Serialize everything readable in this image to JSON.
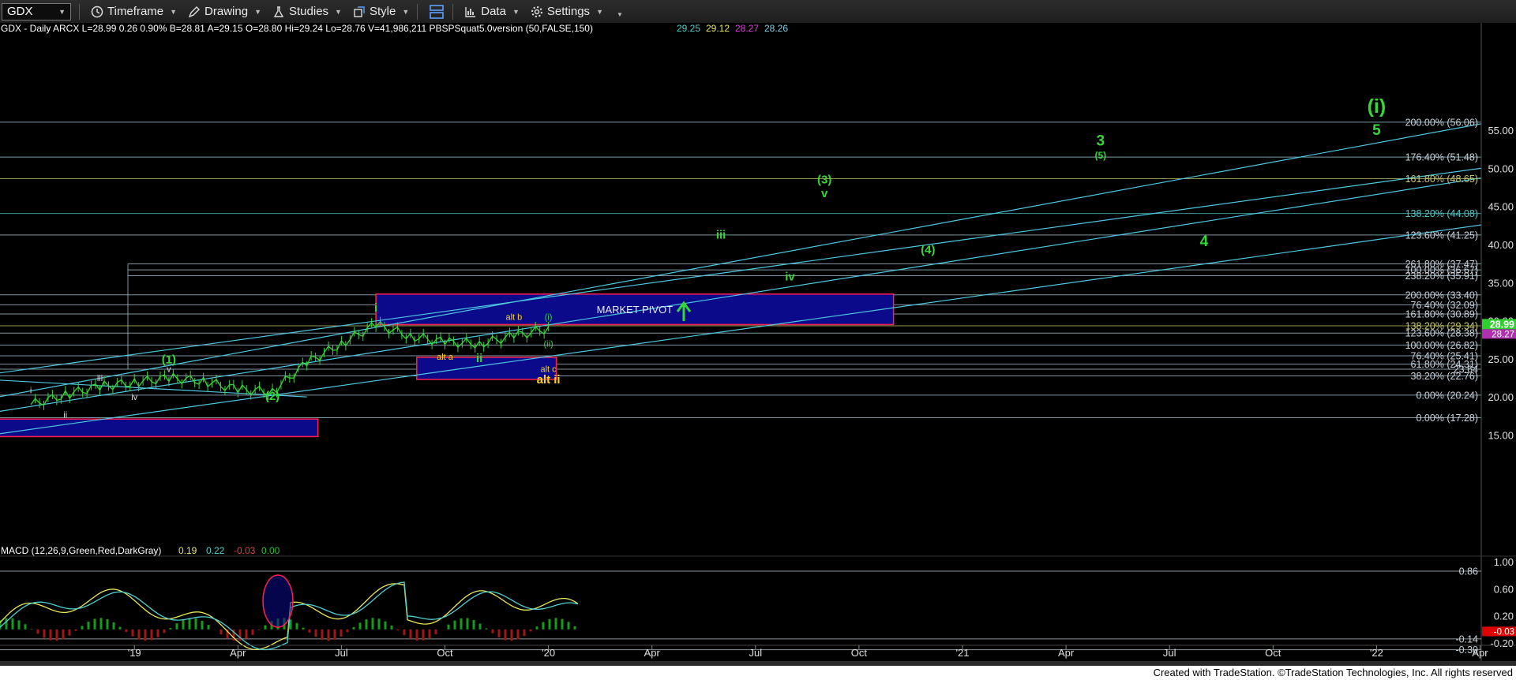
{
  "toolbar": {
    "symbol": "GDX",
    "timeframe_label": "Timeframe",
    "drawing_label": "Drawing",
    "studies_label": "Studies",
    "style_label": "Style",
    "data_label": "Data",
    "settings_label": "Settings"
  },
  "header": {
    "symbol_line": "GDX - Daily  ARCX  L=28.99  0.26  0.90%  B=28.81  A=29.15  O=28.80  Hi=29.24  Lo=28.76  V=41,986,211  PBSPSquat5.0version (50,FALSE,150)",
    "study_values": [
      {
        "text": "29.25",
        "color": "#4fd0d0"
      },
      {
        "text": "29.12",
        "color": "#e8e85a"
      },
      {
        "text": "28.27",
        "color": "#e040e0"
      },
      {
        "text": "28.26",
        "color": "#7fd0e8"
      }
    ]
  },
  "macd": {
    "label": "MACD (12,26,9,Green,Red,DarkGray)",
    "values": [
      {
        "text": "0.19",
        "color": "#e8e85a"
      },
      {
        "text": "0.22",
        "color": "#4fd0d0"
      },
      {
        "text": "-0.03",
        "color": "#e04040"
      },
      {
        "text": "0.00",
        "color": "#2fbf2f"
      }
    ],
    "axis_labels": [
      "1.00",
      "0.60",
      "0.20",
      "-0.20"
    ],
    "level_labels": [
      "0.86",
      "-0.14",
      "-0.30"
    ],
    "current_label": "-0.03"
  },
  "footer": "Created with TradeStation. ©TradeStation Technologies, Inc. All rights reserved",
  "chart_data": {
    "type": "line",
    "title": "GDX - Daily",
    "x_ticks": [
      "'19",
      "Apr",
      "Jul",
      "Oct",
      "'20",
      "Apr",
      "Jul",
      "Oct",
      "'21",
      "Apr",
      "Jul",
      "Oct",
      "'22",
      "Apr"
    ],
    "y_ticks": [
      15,
      20,
      25,
      30,
      35,
      40,
      45,
      50,
      55
    ],
    "ylim": [
      13,
      60
    ],
    "last_price": "28.99",
    "last_price_secondary": "28.27",
    "colors": {
      "price": "#35d835",
      "fib": "#a8c8d8",
      "channel": "#4fc8e0",
      "pivot_fill": "#0a0a8a",
      "pivot_border": "#ff2050",
      "wave_green": "#35d835",
      "wave_yellow": "#ffd21a"
    },
    "price_series": [
      {
        "month": "2018-10",
        "close": 19.0
      },
      {
        "month": "2018-11",
        "close": 20.3
      },
      {
        "month": "2018-12",
        "close": 21.4
      },
      {
        "month": "2019-01",
        "close": 21.9
      },
      {
        "month": "2019-02",
        "close": 22.5
      },
      {
        "month": "2019-03",
        "close": 22.1
      },
      {
        "month": "2019-04",
        "close": 21.0
      },
      {
        "month": "2019-05",
        "close": 20.7
      },
      {
        "month": "2019-06",
        "close": 24.5
      },
      {
        "month": "2019-07",
        "close": 27.0
      },
      {
        "month": "2019-08",
        "close": 29.5
      },
      {
        "month": "2019-09",
        "close": 28.0
      },
      {
        "month": "2019-10",
        "close": 27.2
      },
      {
        "month": "2019-11",
        "close": 27.0
      },
      {
        "month": "2019-12",
        "close": 28.0
      },
      {
        "month": "2020-01",
        "close": 28.99
      }
    ],
    "fib_levels": [
      {
        "label": "200.00% (56.06)",
        "value": 56.06
      },
      {
        "label": "176.40% (51.48)",
        "value": 51.48
      },
      {
        "label": "161.80% (48.65)",
        "value": 48.65,
        "color": "#c8c870"
      },
      {
        "label": "138.20% (44.08)",
        "value": 44.08,
        "color": "#4fc8c8"
      },
      {
        "label": "123.60% (41.25)",
        "value": 41.25
      },
      {
        "label": "261.80% (37.47)",
        "value": 37.47
      },
      {
        "label": "100.00% (36.67)",
        "value": 36.67
      },
      {
        "label": "238.20% (35.91)",
        "value": 35.91
      },
      {
        "label": "200.00% (33.40)",
        "value": 33.4
      },
      {
        "label": "76.40% (32.09)",
        "value": 32.09
      },
      {
        "label": "161.80% (30.89)",
        "value": 30.89
      },
      {
        "label": "138.20% (29.34)",
        "value": 29.34,
        "color": "#c8c870"
      },
      {
        "label": "123.60% (28.38)",
        "value": 28.38
      },
      {
        "label": "100.00% (26.82)",
        "value": 26.82
      },
      {
        "label": "76.40% (25.41)",
        "value": 25.41
      },
      {
        "label": "61.80% (24.31)",
        "value": 24.31
      },
      {
        "label": "23.64",
        "value": 23.64
      },
      {
        "label": "38.20% (22.76)",
        "value": 22.76
      },
      {
        "label": "0.00% (20.24)",
        "value": 20.24
      },
      {
        "label": "0.00% (17.28)",
        "value": 17.28
      }
    ],
    "zones": [
      {
        "label": "MARKET PIVOT",
        "from": "2019-08",
        "to": "2020-11",
        "low": 29.5,
        "high": 33.5
      }
    ],
    "wave_labels": [
      {
        "text": "(i)",
        "color": "green",
        "at": "2022-01",
        "price": 57.3,
        "size": "xl"
      },
      {
        "text": "5",
        "color": "green",
        "at": "2022-01",
        "price": 54.4,
        "size": "lg"
      },
      {
        "text": "3",
        "color": "green",
        "at": "2021-05",
        "price": 53.0,
        "size": "lg"
      },
      {
        "text": "(5)",
        "color": "green",
        "at": "2021-05",
        "price": 51.3,
        "size": "sm"
      },
      {
        "text": "(3)",
        "color": "green",
        "at": "2020-09",
        "price": 48.0,
        "size": "md"
      },
      {
        "text": "v",
        "color": "green",
        "at": "2020-09",
        "price": 46.2,
        "size": "md"
      },
      {
        "text": "iii",
        "color": "green",
        "at": "2020-06",
        "price": 40.8,
        "size": "md"
      },
      {
        "text": "(4)",
        "color": "green",
        "at": "2020-12",
        "price": 38.8,
        "size": "md"
      },
      {
        "text": "4",
        "color": "green",
        "at": "2021-08",
        "price": 39.8,
        "size": "lg"
      },
      {
        "text": "iv",
        "color": "green",
        "at": "2020-08",
        "price": 35.3,
        "size": "md"
      },
      {
        "text": "i",
        "color": "green",
        "at": "2019-08",
        "price": 31.2,
        "size": "md"
      },
      {
        "text": "alt b",
        "color": "yellow",
        "at": "2019-12",
        "price": 30.1,
        "size": "xs"
      },
      {
        "text": "(i)",
        "color": "green",
        "at": "2020-01",
        "price": 30.1,
        "size": "xs"
      },
      {
        "text": "(ii)",
        "color": "green",
        "at": "2020-01",
        "price": 26.6,
        "size": "xs"
      },
      {
        "text": "alt a",
        "color": "yellow",
        "at": "2019-10",
        "price": 24.9,
        "size": "xs"
      },
      {
        "text": "ii",
        "color": "green",
        "at": "2019-11",
        "price": 24.6,
        "size": "md"
      },
      {
        "text": "alt c",
        "color": "yellow",
        "at": "2020-01",
        "price": 23.3,
        "size": "xs"
      },
      {
        "text": "alt ii",
        "color": "yellow",
        "at": "2020-01",
        "price": 21.8,
        "size": "md"
      },
      {
        "text": "(1)",
        "color": "green",
        "at": "2019-02",
        "price": 24.4,
        "size": "md"
      },
      {
        "text": "v",
        "color": "white",
        "at": "2019-02",
        "price": 23.3,
        "size": "xs"
      },
      {
        "text": "iii",
        "color": "white",
        "at": "2018-12",
        "price": 22.1,
        "size": "xs"
      },
      {
        "text": "iv",
        "color": "white",
        "at": "2019-01",
        "price": 19.6,
        "size": "xs"
      },
      {
        "text": "(2)",
        "color": "green",
        "at": "2019-05",
        "price": 19.6,
        "size": "md"
      },
      {
        "text": "ii",
        "color": "white",
        "at": "2018-11",
        "price": 17.3,
        "size": "xs"
      },
      {
        "text": "i",
        "color": "white",
        "at": "2018-10",
        "price": 20.5,
        "size": "xs"
      }
    ],
    "macd_ylim": [
      -0.45,
      1.1
    ]
  }
}
